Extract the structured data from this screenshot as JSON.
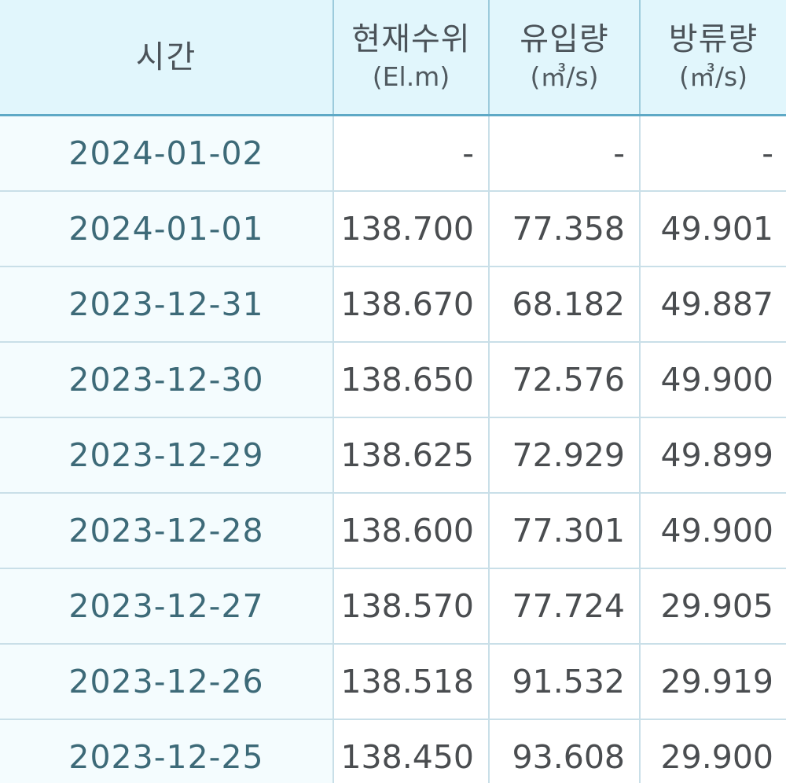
{
  "table": {
    "headers": {
      "time": "시간",
      "level_main": "현재수위",
      "level_unit": "(El.m)",
      "inflow_main": "유입량",
      "inflow_unit": "(㎥/s)",
      "outflow_main": "방류량",
      "outflow_unit": "(㎥/s)"
    },
    "rows": [
      {
        "time": "2024-01-02",
        "level": "-",
        "inflow": "-",
        "outflow": "-"
      },
      {
        "time": "2024-01-01",
        "level": "138.700",
        "inflow": "77.358",
        "outflow": "49.901"
      },
      {
        "time": "2023-12-31",
        "level": "138.670",
        "inflow": "68.182",
        "outflow": "49.887"
      },
      {
        "time": "2023-12-30",
        "level": "138.650",
        "inflow": "72.576",
        "outflow": "49.900"
      },
      {
        "time": "2023-12-29",
        "level": "138.625",
        "inflow": "72.929",
        "outflow": "49.899"
      },
      {
        "time": "2023-12-28",
        "level": "138.600",
        "inflow": "77.301",
        "outflow": "49.900"
      },
      {
        "time": "2023-12-27",
        "level": "138.570",
        "inflow": "77.724",
        "outflow": "29.905"
      },
      {
        "time": "2023-12-26",
        "level": "138.518",
        "inflow": "91.532",
        "outflow": "29.919"
      },
      {
        "time": "2023-12-25",
        "level": "138.450",
        "inflow": "93.608",
        "outflow": "29.900"
      }
    ]
  },
  "colors": {
    "header_bg": "#e1f6fc",
    "header_border": "#5ea9c6",
    "time_text": "#3d6a78",
    "value_text": "#4a4d50"
  }
}
